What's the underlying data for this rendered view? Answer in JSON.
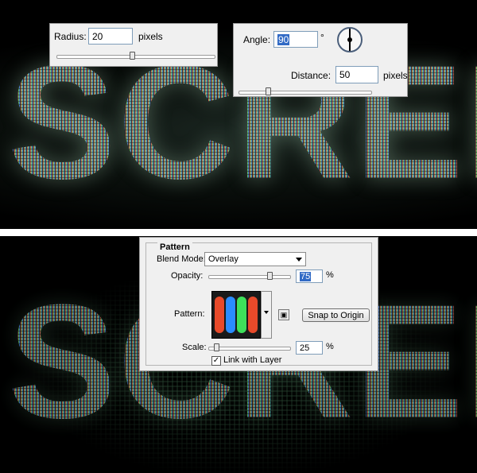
{
  "canvas": {
    "word": "SCREEN"
  },
  "radius_panel": {
    "label": "Radius:",
    "value": "20",
    "unit": "pixels",
    "slider_fraction": 0.48
  },
  "angle_panel": {
    "angle_label": "Angle:",
    "angle_value": "90",
    "angle_unit": "°",
    "distance_label": "Distance:",
    "distance_value": "50",
    "distance_unit": "pixels",
    "slider_fraction": 0.22
  },
  "pattern_panel": {
    "title": "Pattern",
    "blend_mode_label": "Blend Mode:",
    "blend_mode_value": "Overlay",
    "opacity_label": "Opacity:",
    "opacity_value": "75",
    "opacity_unit": "%",
    "opacity_fraction": 0.75,
    "pattern_label": "Pattern:",
    "snap_button": "Snap to Origin",
    "scale_label": "Scale:",
    "scale_value": "25",
    "scale_unit": "%",
    "scale_fraction": 0.1,
    "link_label": "Link with Layer",
    "link_checked": "✓",
    "swatch_colors": [
      "#e84a2a",
      "#2a8cff",
      "#3ee05a",
      "#e84a2a"
    ]
  }
}
